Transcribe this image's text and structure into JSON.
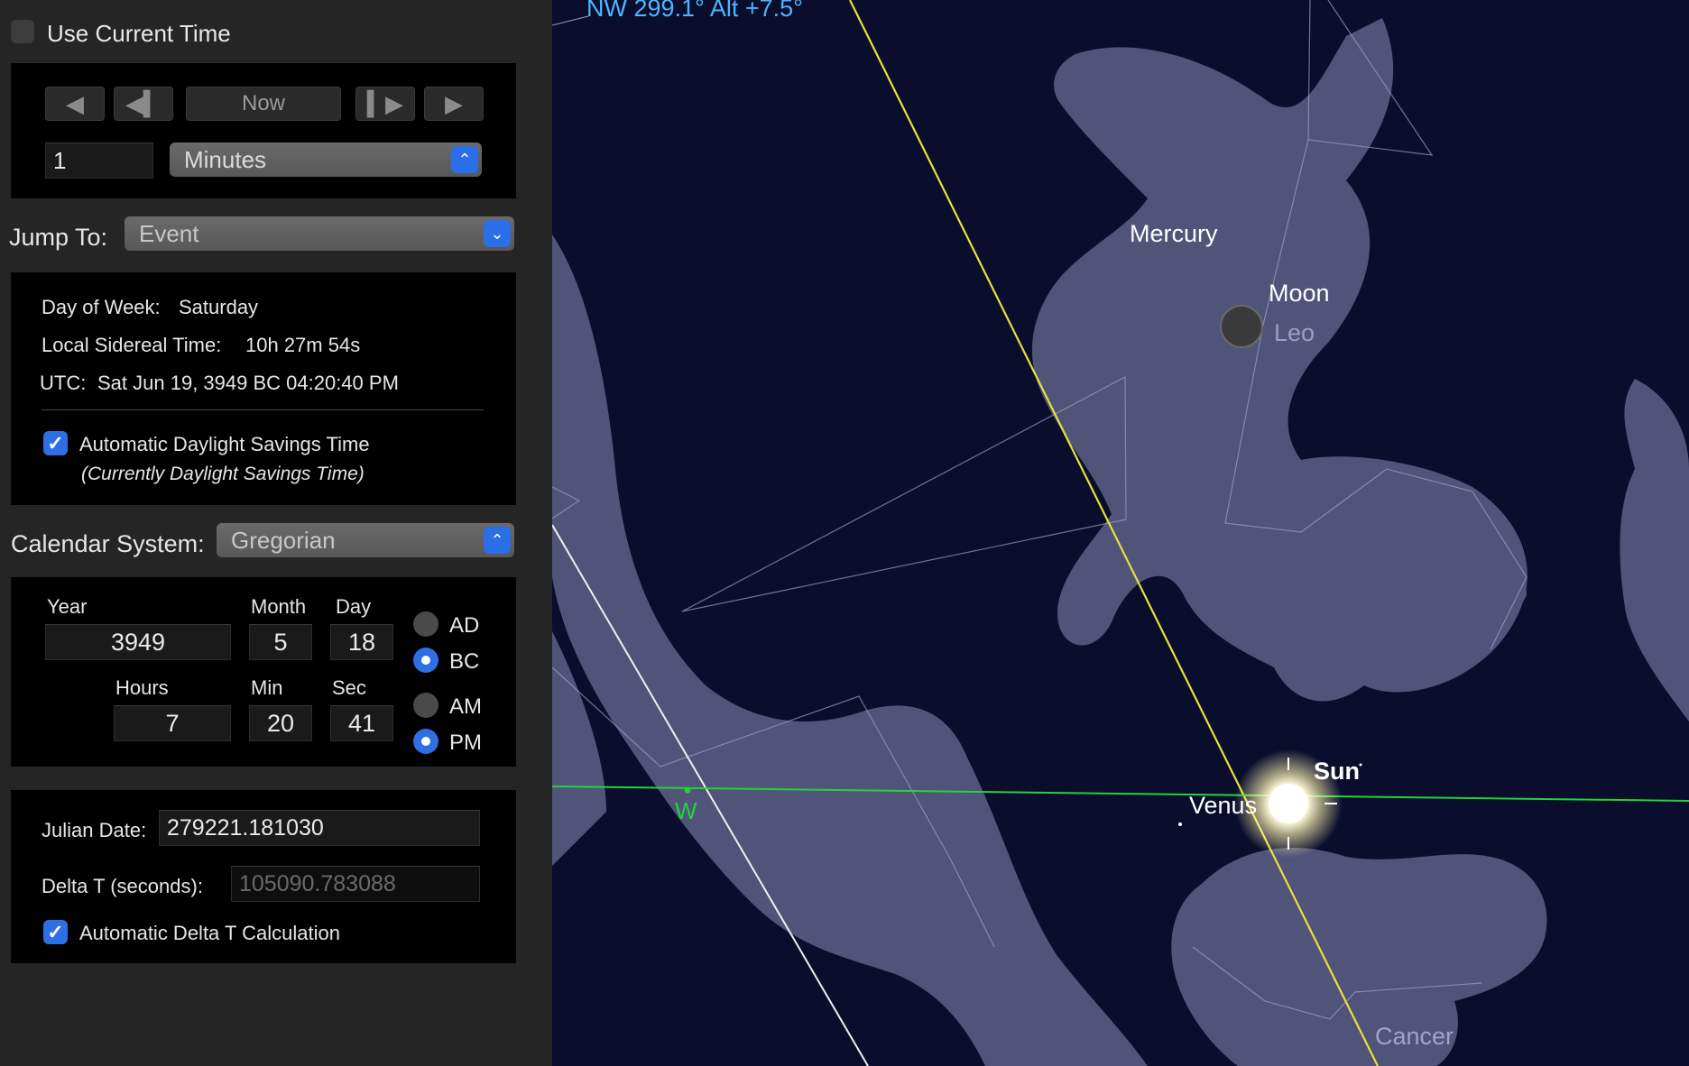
{
  "panel": {
    "use_current_time": {
      "label": "Use Current Time",
      "checked": false
    },
    "step_controls": {
      "now_label": "Now",
      "step_value": "1",
      "step_unit": "Minutes"
    },
    "jump_to": {
      "label": "Jump To:",
      "value": "Event"
    },
    "info": {
      "day_of_week_label": "Day of Week:",
      "day_of_week_value": "Saturday",
      "lst_label": "Local Sidereal Time:",
      "lst_value": "10h 27m 54s",
      "utc_label": "UTC:",
      "utc_value": "Sat Jun 19, 3949 BC 04:20:40 PM",
      "auto_dst_label": "Automatic Daylight Savings Time",
      "auto_dst_checked": true,
      "dst_status": "(Currently Daylight Savings Time)"
    },
    "calendar": {
      "label": "Calendar System:",
      "value": "Gregorian"
    },
    "datetime": {
      "year_label": "Year",
      "year": "3949",
      "month_label": "Month",
      "month": "5",
      "day_label": "Day",
      "day": "18",
      "hours_label": "Hours",
      "hours": "7",
      "min_label": "Min",
      "min": "20",
      "sec_label": "Sec",
      "sec": "41",
      "era_ad": "AD",
      "era_bc": "BC",
      "era_selected": "BC",
      "am": "AM",
      "pm": "PM",
      "meridiem_selected": "PM"
    },
    "julian": {
      "julian_label": "Julian Date:",
      "julian_value": "279221.181030",
      "delta_t_label": "Delta T (seconds):",
      "delta_t_value": "105090.783088",
      "auto_delta_t_label": "Automatic Delta T Calculation",
      "auto_delta_t_checked": true
    }
  },
  "sky": {
    "readout": "NW 299.1° Alt +7.5°",
    "labels": {
      "mercury": "Mercury",
      "moon": "Moon",
      "leo": "Leo",
      "sun": "Sun",
      "venus": "Venus",
      "cancer": "Cancer",
      "west": "W"
    },
    "colors": {
      "background": "#0a0d2c",
      "constellation_art": "#8a8fb8",
      "ecliptic": "#e8e13a",
      "horizon": "#22d43a",
      "readout": "#4fb4ff"
    }
  }
}
